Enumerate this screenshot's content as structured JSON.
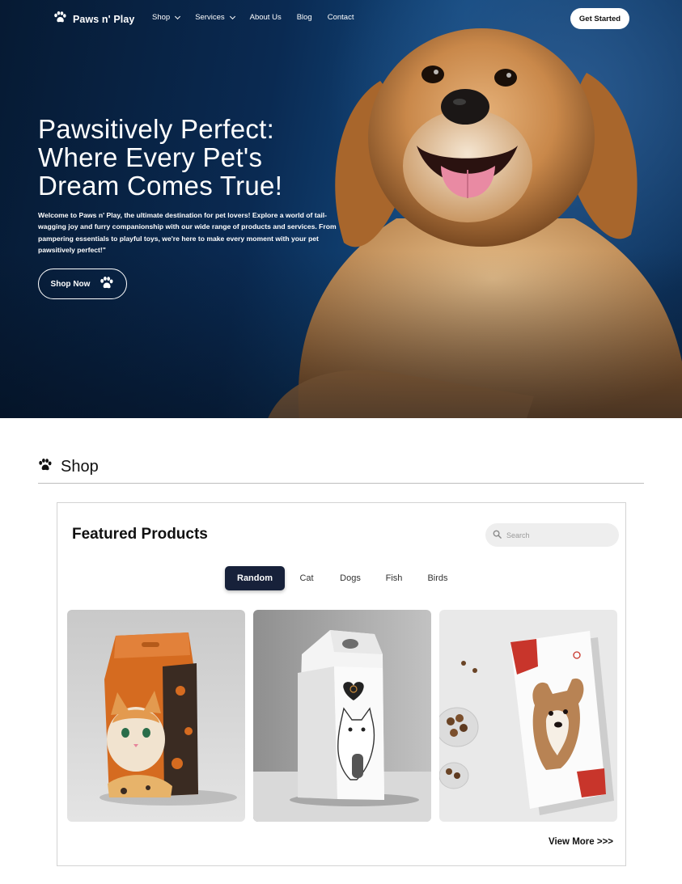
{
  "nav": {
    "brand": "Paws n' Play",
    "items": [
      {
        "label": "Shop",
        "dropdown": true
      },
      {
        "label": "Services",
        "dropdown": true
      },
      {
        "label": "About Us",
        "dropdown": false
      },
      {
        "label": "Blog",
        "dropdown": false
      },
      {
        "label": "Contact",
        "dropdown": false
      }
    ],
    "cta_label": "Get Started"
  },
  "hero": {
    "title_lines": [
      "Pawsitively Perfect:",
      "Where Every Pet's",
      "Dream Comes True!"
    ],
    "description": "Welcome to Paws n' Play, the ultimate destination for pet lovers! Explore a world of tail-wagging joy and furry companionship with our wide range of products and services. From pampering essentials to playful toys, we're here to make every moment with your pet pawsitively perfect!\"",
    "button_label": "Shop Now"
  },
  "shop": {
    "section_title": "Shop",
    "featured_title": "Featured Products",
    "search_placeholder": "Search",
    "tabs": [
      {
        "label": "Random",
        "active": true
      },
      {
        "label": "Cat",
        "active": false
      },
      {
        "label": "Dogs",
        "active": false
      },
      {
        "label": "Fish",
        "active": false
      },
      {
        "label": "Birds",
        "active": false
      }
    ],
    "products": [
      {
        "name": "cat-food-orange-bag"
      },
      {
        "name": "white-cat-box"
      },
      {
        "name": "dog-food-bag"
      }
    ],
    "view_more_label": "View More >>>"
  },
  "colors": {
    "hero_blue": "#0a2a52",
    "tab_active": "#17213a",
    "white": "#ffffff"
  }
}
